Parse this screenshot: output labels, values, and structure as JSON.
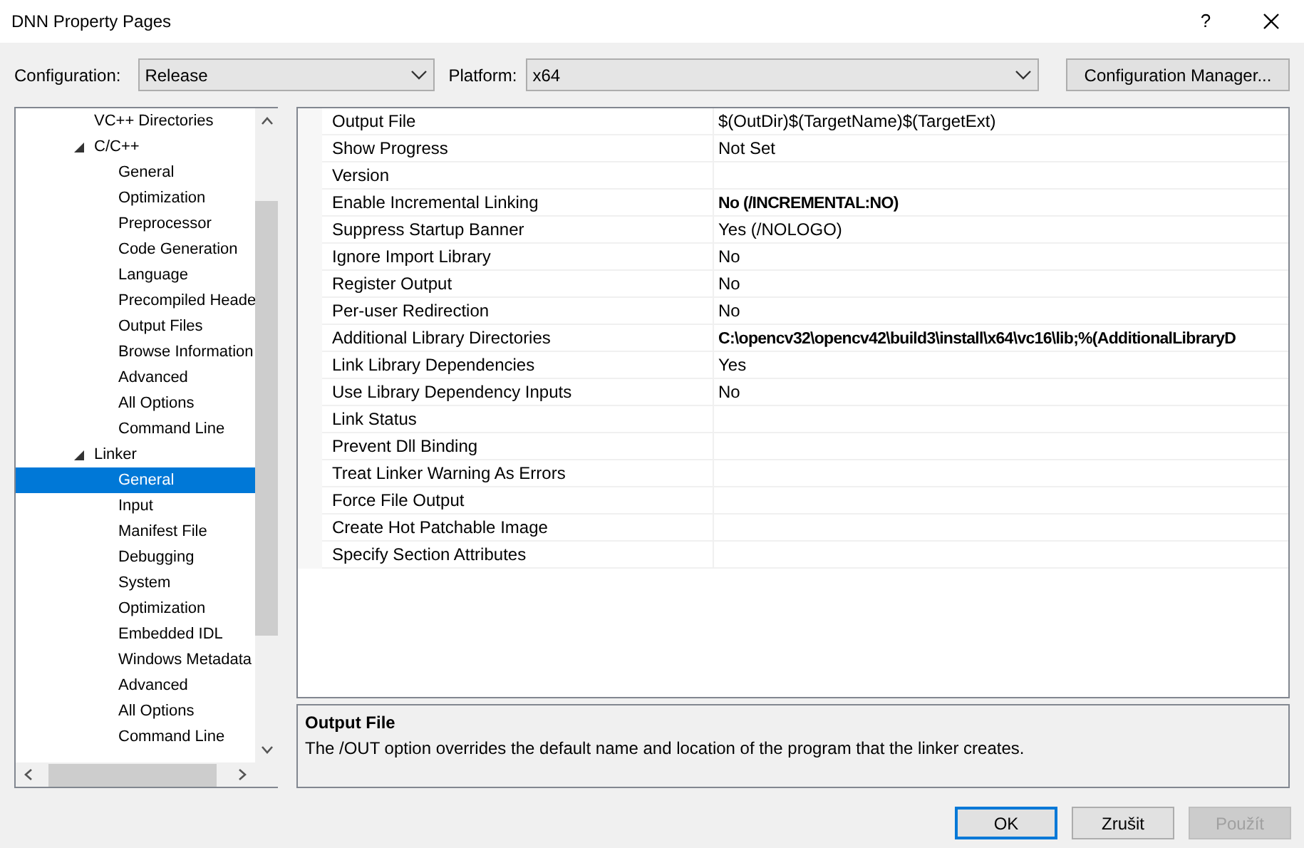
{
  "window": {
    "title": "DNN Property Pages",
    "help": "?"
  },
  "configuration": {
    "label": "Configuration:",
    "value": "Release"
  },
  "platform": {
    "label": "Platform:",
    "value": "x64"
  },
  "config_manager_button": "Configuration Manager...",
  "tree": [
    {
      "label": "VC++ Directories",
      "selected": false
    },
    {
      "label": "C/C++",
      "expanded": true,
      "selected": false,
      "children": [
        {
          "label": "General",
          "selected": false
        },
        {
          "label": "Optimization",
          "selected": false
        },
        {
          "label": "Preprocessor",
          "selected": false
        },
        {
          "label": "Code Generation",
          "selected": false
        },
        {
          "label": "Language",
          "selected": false
        },
        {
          "label": "Precompiled Heade",
          "selected": false
        },
        {
          "label": "Output Files",
          "selected": false
        },
        {
          "label": "Browse Information",
          "selected": false
        },
        {
          "label": "Advanced",
          "selected": false
        },
        {
          "label": "All Options",
          "selected": false
        },
        {
          "label": "Command Line",
          "selected": false
        }
      ]
    },
    {
      "label": "Linker",
      "expanded": true,
      "selected": false,
      "children": [
        {
          "label": "General",
          "selected": true
        },
        {
          "label": "Input",
          "selected": false
        },
        {
          "label": "Manifest File",
          "selected": false
        },
        {
          "label": "Debugging",
          "selected": false
        },
        {
          "label": "System",
          "selected": false
        },
        {
          "label": "Optimization",
          "selected": false
        },
        {
          "label": "Embedded IDL",
          "selected": false
        },
        {
          "label": "Windows Metadata",
          "selected": false
        },
        {
          "label": "Advanced",
          "selected": false
        },
        {
          "label": "All Options",
          "selected": false
        },
        {
          "label": "Command Line",
          "selected": false
        }
      ]
    }
  ],
  "properties": [
    {
      "name": "Output File",
      "value": "$(OutDir)$(TargetName)$(TargetExt)",
      "bold": false
    },
    {
      "name": "Show Progress",
      "value": "Not Set",
      "bold": false
    },
    {
      "name": "Version"
    },
    {
      "name": "Enable Incremental Linking",
      "value": "No (/INCREMENTAL:NO)",
      "bold": true
    },
    {
      "name": "Suppress Startup Banner",
      "value": "Yes (/NOLOGO)",
      "bold": false
    },
    {
      "name": "Ignore Import Library",
      "value": "No",
      "bold": false
    },
    {
      "name": "Register Output",
      "value": "No",
      "bold": false
    },
    {
      "name": "Per-user Redirection",
      "value": "No",
      "bold": false
    },
    {
      "name": "Additional Library Directories",
      "value": "C:\\opencv32\\opencv42\\build3\\install\\x64\\vc16\\lib;%(AdditionalLibraryD",
      "bold": true
    },
    {
      "name": "Link Library Dependencies",
      "value": "Yes",
      "bold": false
    },
    {
      "name": "Use Library Dependency Inputs",
      "value": "No",
      "bold": false
    },
    {
      "name": "Link Status"
    },
    {
      "name": "Prevent Dll Binding"
    },
    {
      "name": "Treat Linker Warning As Errors"
    },
    {
      "name": "Force File Output"
    },
    {
      "name": "Create Hot Patchable Image"
    },
    {
      "name": "Specify Section Attributes"
    }
  ],
  "description": {
    "title": "Output File",
    "text": "The /OUT option overrides the default name and location of the program that the linker creates."
  },
  "buttons": [
    {
      "label": "OK",
      "default": true,
      "disabled": false
    },
    {
      "label": "Zrušit",
      "default": false,
      "disabled": false
    },
    {
      "label": "Použít",
      "default": false,
      "disabled": true
    }
  ]
}
